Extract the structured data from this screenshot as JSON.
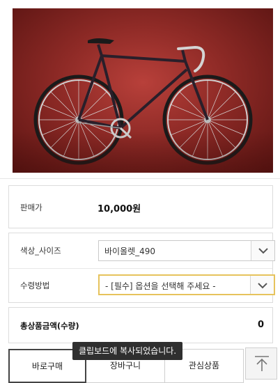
{
  "product": {
    "image_alt": "bicycle-photo",
    "price_label": "판매가",
    "price_value": "10,000원"
  },
  "options": [
    {
      "label": "색상_사이즈",
      "value": "바이올렛_490"
    },
    {
      "label": "수령방법",
      "value": "- [필수] 옵션을 선택해 주세요 -"
    }
  ],
  "total": {
    "label": "총상품금액(수량)",
    "value": "0"
  },
  "actions": {
    "buy_now": "바로구매",
    "cart": "장바구니",
    "wishlist": "관심상품"
  },
  "toast": {
    "message": "클립보드에 복사되었습니다."
  },
  "icons": {
    "dropdown": "chevron-down-icon",
    "scroll_top": "arrow-up-icon"
  },
  "colors": {
    "photo_background": "#8e2a26",
    "required_select_border": "#e6c35c",
    "toast_background": "#2f2f2f"
  }
}
